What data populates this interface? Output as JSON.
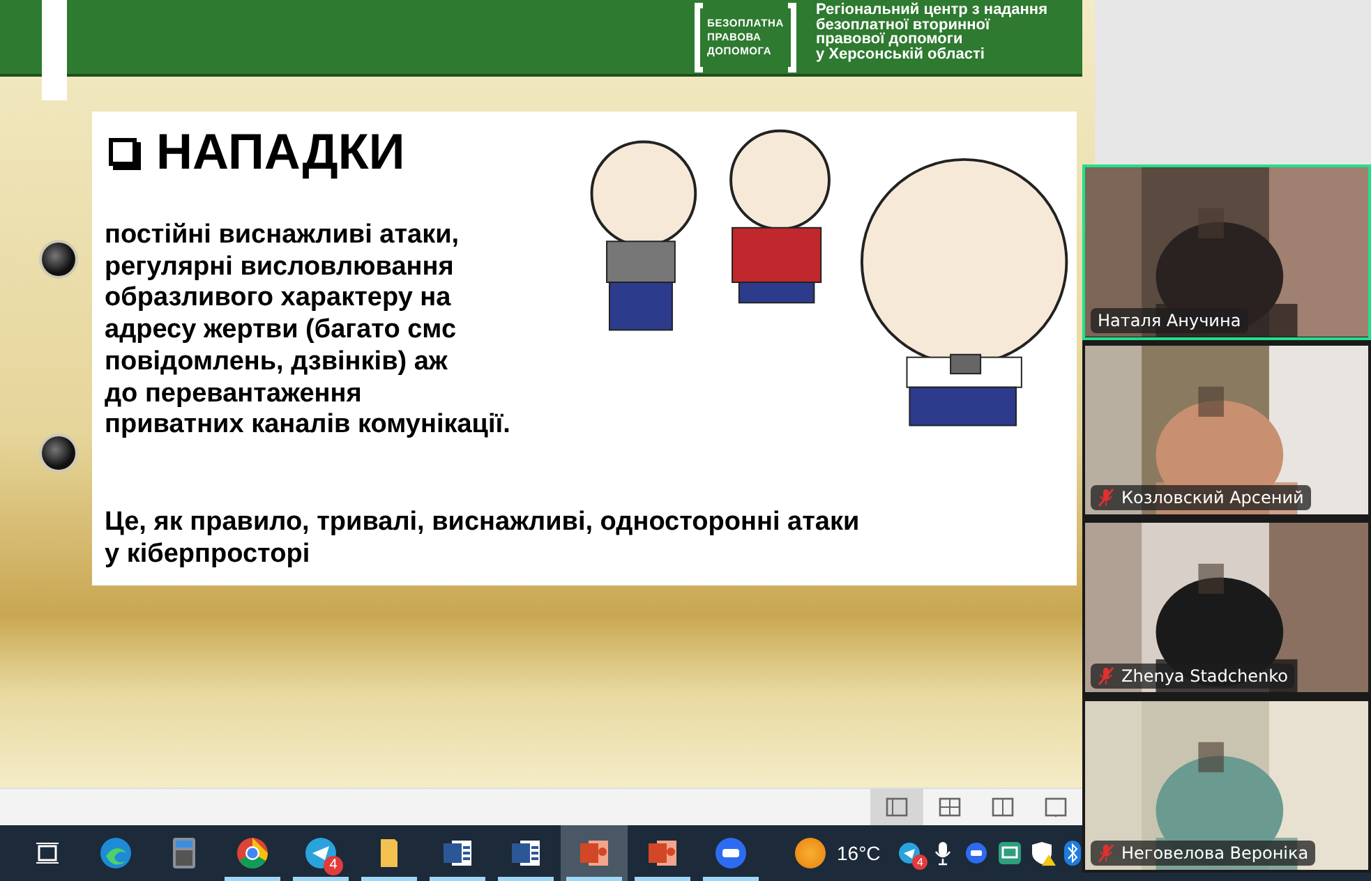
{
  "slide": {
    "logo": {
      "lines": [
        "БЕЗОПЛАТНА",
        "ПРАВОВА",
        "ДОПОМОГА"
      ]
    },
    "org": [
      "Регіональний центр з надання",
      "безоплатної вторинної",
      "правової допомоги",
      "у Херсонській області"
    ],
    "title": "НАПАДКИ",
    "paragraph": [
      "постійні виснажливі атаки,",
      "регулярні висловлювання",
      "образливого характеру на",
      "адресу жертви (багато смс",
      "повідомлень, дзвінків) аж",
      "до перевантаження",
      "приватних каналів комунікації."
    ],
    "summary": [
      "Це, як правило, тривалі, виснажливі, односторонні атаки",
      "у кіберпросторі"
    ]
  },
  "view_buttons": [
    {
      "kind": "normal",
      "selected": true
    },
    {
      "kind": "sorter",
      "selected": false
    },
    {
      "kind": "reading",
      "selected": false
    },
    {
      "kind": "show",
      "selected": false
    }
  ],
  "participants": [
    {
      "name": "Наталя Анучина",
      "muted": false,
      "speaking": true
    },
    {
      "name": "Козловский Арсений",
      "muted": true,
      "speaking": false
    },
    {
      "name": "Zhenya Stadchenko",
      "muted": true,
      "speaking": false
    },
    {
      "name": "Неговелова Вероніка",
      "muted": true,
      "speaking": false
    }
  ],
  "taskbar": {
    "apps": [
      {
        "kind": "taskview",
        "running": false,
        "selected": false
      },
      {
        "kind": "edge",
        "running": false,
        "selected": false
      },
      {
        "kind": "calculator",
        "running": false,
        "selected": false
      },
      {
        "kind": "chrome",
        "running": true,
        "selected": false
      },
      {
        "kind": "telegram",
        "running": true,
        "selected": false,
        "badge": "4"
      },
      {
        "kind": "folder",
        "running": true,
        "selected": false
      },
      {
        "kind": "word",
        "running": true,
        "selected": false
      },
      {
        "kind": "word",
        "running": true,
        "selected": false
      },
      {
        "kind": "powerpoint",
        "running": true,
        "selected": true
      },
      {
        "kind": "powerpoint",
        "running": true,
        "selected": false
      },
      {
        "kind": "zoom",
        "running": true,
        "selected": false
      }
    ],
    "weather": "16°C",
    "tray": [
      {
        "kind": "telegram",
        "badge": "4"
      },
      {
        "kind": "mic"
      },
      {
        "kind": "zoom"
      },
      {
        "kind": "sync"
      },
      {
        "kind": "shield"
      },
      {
        "kind": "bluetooth"
      }
    ]
  }
}
